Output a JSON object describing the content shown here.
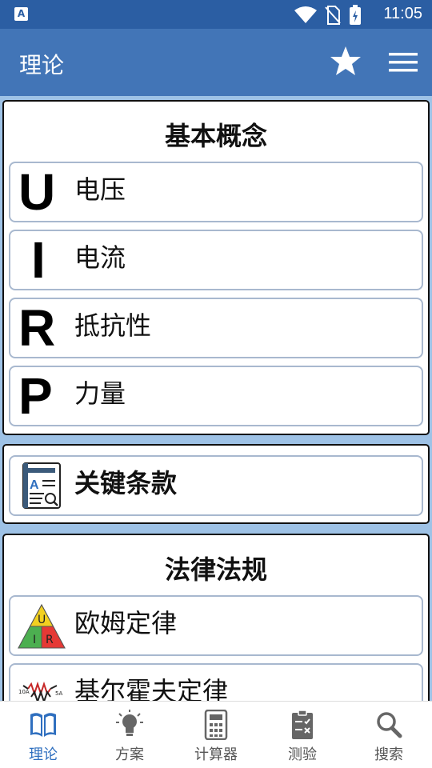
{
  "status": {
    "time": "11:05",
    "app_indicator": "A"
  },
  "appbar": {
    "title": "理论",
    "favorite_icon": "star-icon",
    "menu_icon": "menu-icon"
  },
  "sections": {
    "basic": {
      "title": "基本概念",
      "items": [
        {
          "symbol": "U",
          "label": "电压"
        },
        {
          "symbol": "I",
          "label": "电流"
        },
        {
          "symbol": "R",
          "label": "抵抗性"
        },
        {
          "symbol": "P",
          "label": "力量"
        }
      ]
    },
    "terms": {
      "label": "关键条款",
      "icon": "glossary-book-icon"
    },
    "laws": {
      "title": "法律法规",
      "items": [
        {
          "label": "欧姆定律",
          "icon": "ohms-law-triangle-icon",
          "triangle": [
            "U",
            "I",
            "R"
          ]
        },
        {
          "label": "基尔霍夫定律",
          "icon": "kirchhoff-circuit-icon",
          "annotations": [
            "10A",
            "5A"
          ]
        }
      ]
    }
  },
  "bottom_nav": [
    {
      "label": "理论",
      "icon": "book-icon",
      "active": true
    },
    {
      "label": "方案",
      "icon": "lightbulb-icon",
      "active": false
    },
    {
      "label": "计算器",
      "icon": "calculator-icon",
      "active": false
    },
    {
      "label": "测验",
      "icon": "quiz-clipboard-icon",
      "active": false
    },
    {
      "label": "搜索",
      "icon": "search-icon",
      "active": false
    }
  ],
  "colors": {
    "status_bar": "#2b5ea3",
    "app_bar": "#4275b7",
    "background": "#9ec2e6",
    "accent": "#2f6fbf"
  }
}
